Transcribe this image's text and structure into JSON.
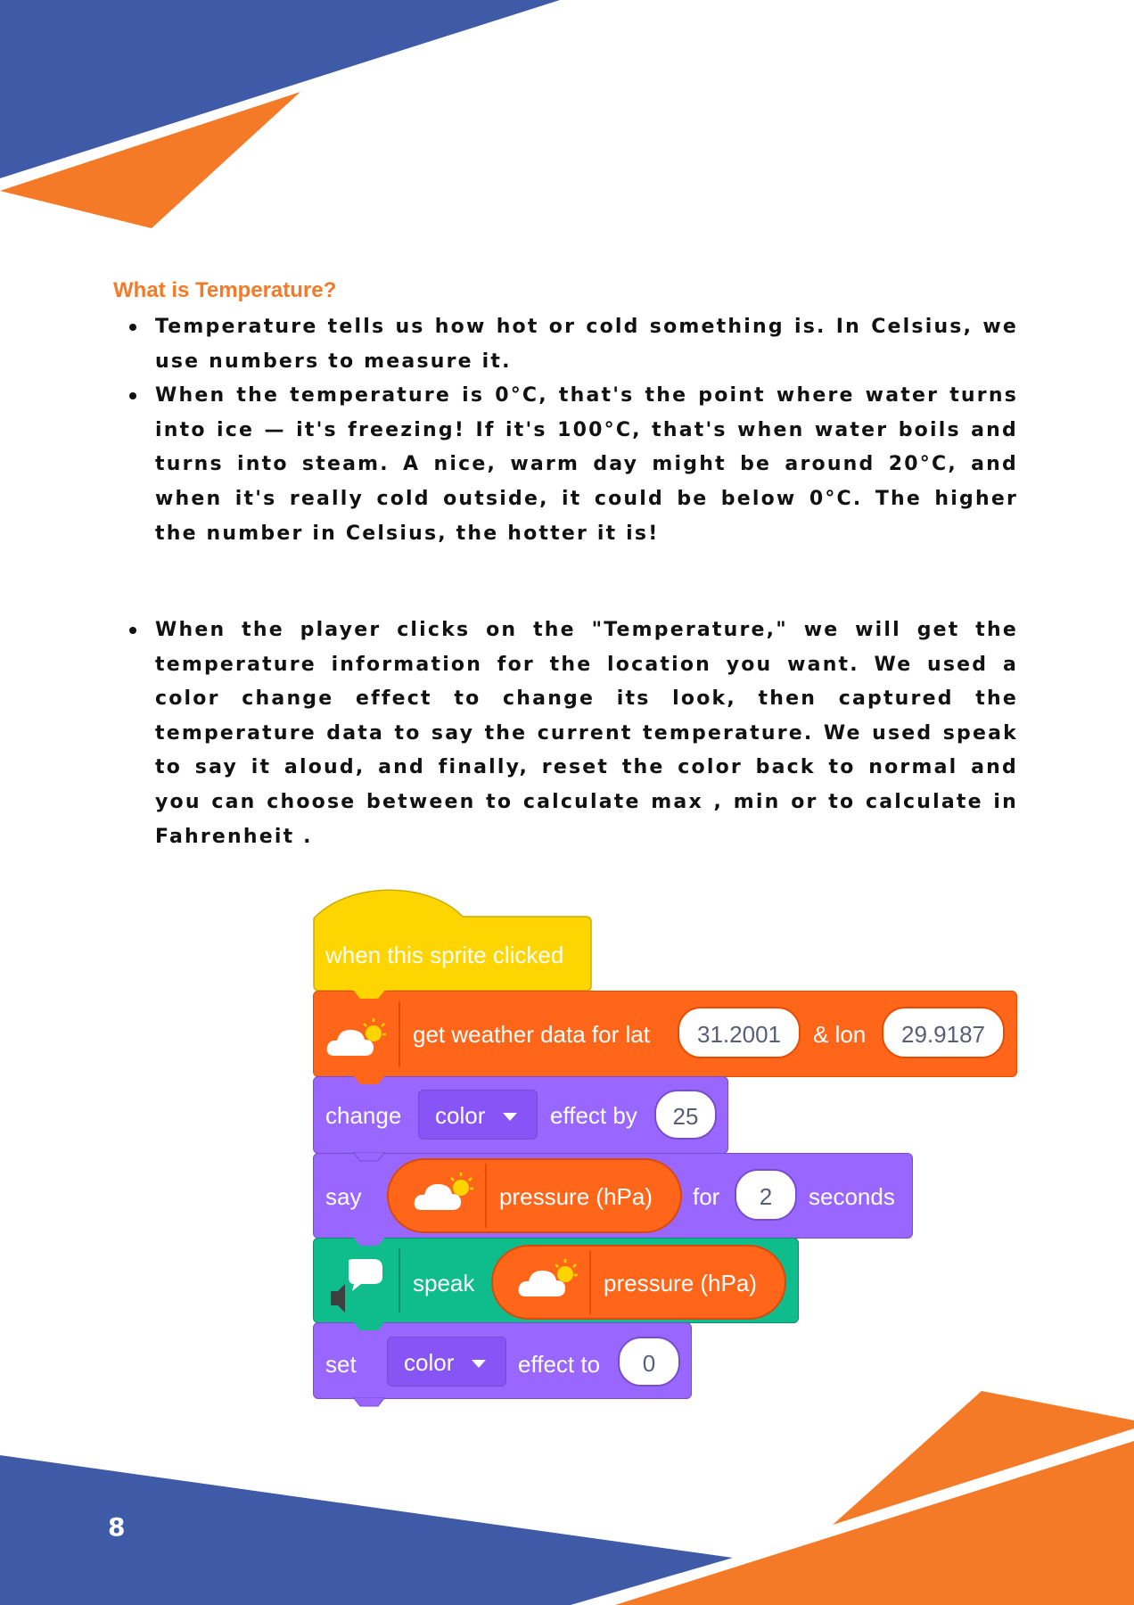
{
  "section_title": "What is Temperature?",
  "intro_bullets": [
    "Temperature tells us how hot or cold something is. In Celsius, we use numbers to measure it.",
    "When the temperature is 0°C, that's the point where water turns into ice — it's freezing! If it's 100°C, that's when water boils and turns into steam. A nice, warm day might be around 20°C, and when it's really cold outside, it could be below 0°C. The higher the number in Celsius, the hotter it is!"
  ],
  "explanation_bullet": "When the player clicks on the \"Temperature,\" we will get the temperature information for the location you want. We used a color change effect to change its look, then captured the temperature data to say the current temperature. We used speak to say it aloud, and finally, reset the color back to normal and you can choose between to calculate max , min or to calculate in Fahrenheit .",
  "script": {
    "hat_label": "when this sprite clicked",
    "weather": {
      "label": "get weather data for lat",
      "lat": "31.2001",
      "lon_label": "& lon",
      "lon": "29.9187"
    },
    "change": {
      "label": "change",
      "effect": "color",
      "by_label": "effect by",
      "amount": "25"
    },
    "say": {
      "label": "say",
      "reporter": "pressure (hPa)",
      "for_label": "for",
      "secs": "2",
      "seconds_label": "seconds"
    },
    "speak": {
      "label": "speak",
      "reporter": "pressure (hPa)"
    },
    "set": {
      "label": "set",
      "effect": "color",
      "to_label": "effect to",
      "value": "0"
    },
    "icons": [
      "weather-cloud-icon",
      "speech-bubble-icon",
      "speaker-icon",
      "dropdown-arrow-icon"
    ]
  },
  "colors": {
    "brand_blue": "#3f5ba8",
    "brand_orange": "#f47a27",
    "events_yellow": "#ffd500",
    "extension_orange": "#ff661a",
    "looks_purple": "#9966ff",
    "text2speech_green": "#0fbd8c"
  },
  "page_number": "8"
}
